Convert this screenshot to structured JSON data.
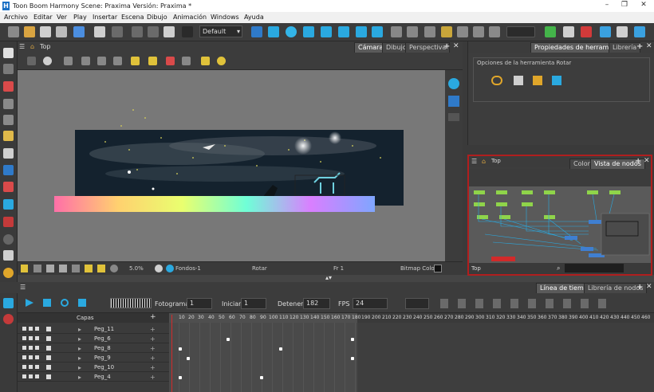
{
  "window": {
    "title": "Toon Boom Harmony Scene: Praxima Versión: Praxima *",
    "logo": "H"
  },
  "menu": [
    "Archivo",
    "Editar",
    "Ver",
    "Play",
    "Insertar",
    "Escena",
    "Dibujo",
    "Animación",
    "Windows",
    "Ayuda"
  ],
  "toolbar": {
    "preset": "Default"
  },
  "view": {
    "breadcrumb": "Top",
    "tabs": [
      "Cámara",
      "Dibujo",
      "Perspectiva"
    ],
    "status": {
      "zoom": "5.0%",
      "node": "Fondos-1",
      "tool": "Rotar",
      "frame": "Fr 1",
      "bitmap": "Bitmap Colour"
    }
  },
  "properties": {
    "tabs": [
      "Propiedades de herramienta",
      "Librería"
    ],
    "section": "Opciones de la herramienta Rotar"
  },
  "nodeview": {
    "breadcrumb": "Top",
    "tabs": [
      "Color",
      "Vista de nodos"
    ],
    "footer": "Top"
  },
  "timeline": {
    "tabs": [
      "Línea de tiempo",
      "Librería de nodos"
    ],
    "fields": {
      "frame_label": "Fotograma",
      "frame": "1",
      "start_label": "Iniciar",
      "start": "1",
      "stop_label": "Detener",
      "stop": "182",
      "fps_label": "FPS",
      "fps": "24"
    },
    "layers_header": "Capas",
    "layers": [
      "Peg_11",
      "Peg_6",
      "Peg_8",
      "Peg_9",
      "Peg_10",
      "Peg_4"
    ],
    "ruler": [
      "10",
      "20",
      "30",
      "40",
      "50",
      "60",
      "70",
      "80",
      "90",
      "100",
      "110",
      "120",
      "130",
      "140",
      "150",
      "160",
      "170",
      "180",
      "190",
      "200",
      "210",
      "220",
      "230",
      "240",
      "250",
      "260",
      "270",
      "280",
      "290",
      "300",
      "310",
      "320",
      "330",
      "340",
      "350",
      "360",
      "370",
      "380",
      "390",
      "400",
      "410",
      "420",
      "430",
      "440",
      "450",
      "460"
    ]
  },
  "colors": {
    "accent_red": "#b01e1e",
    "viewport_bg": "#787878",
    "node_green": "#8fd44a"
  }
}
